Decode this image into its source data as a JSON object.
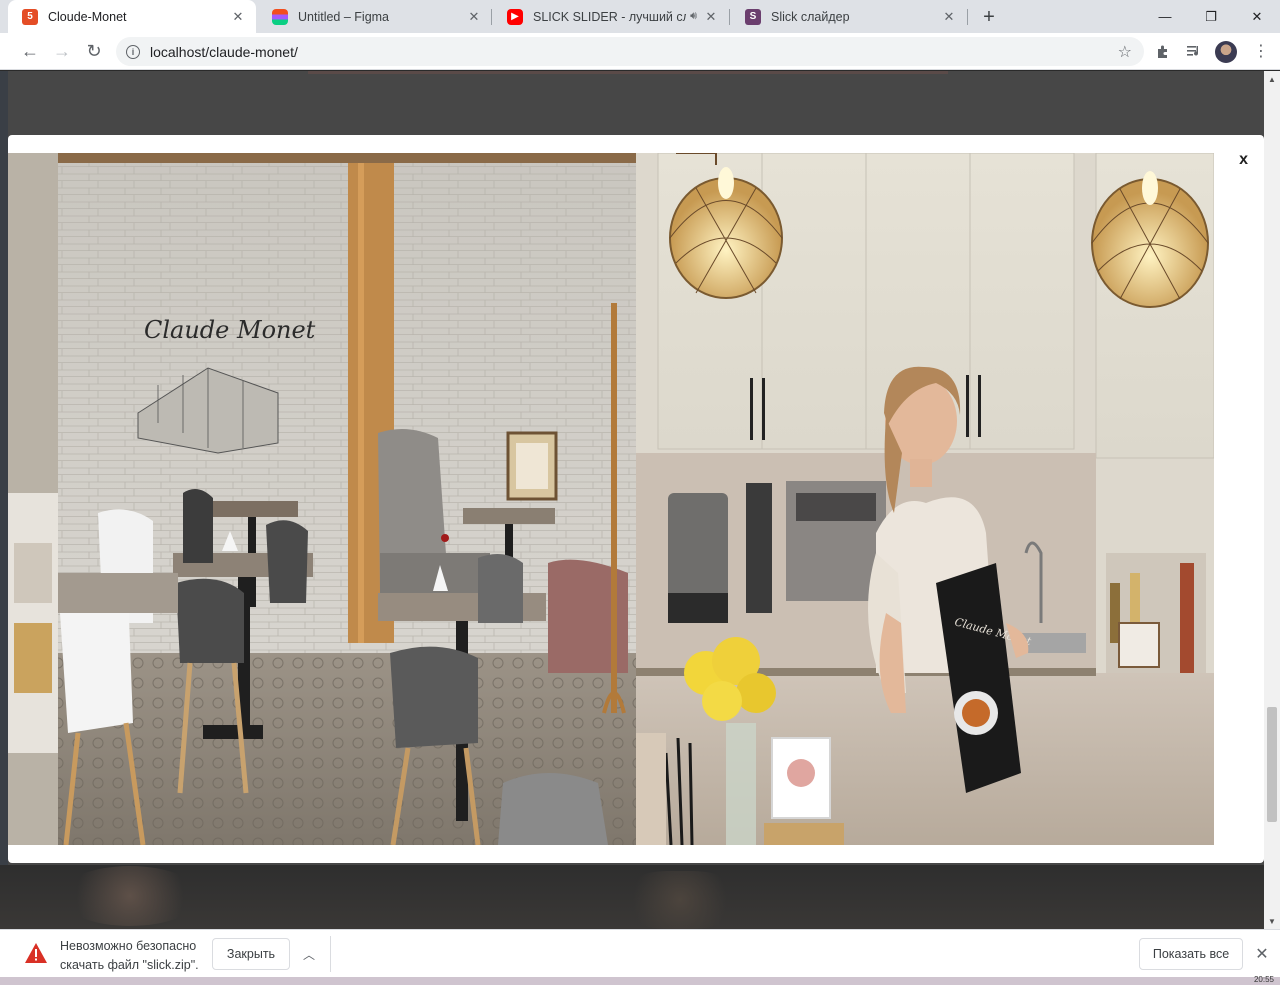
{
  "tabs": [
    {
      "title": "Cloude-Monet",
      "active": true,
      "favicon": "html-icon",
      "color": "#e44d26"
    },
    {
      "title": "Untitled – Figma",
      "active": false,
      "favicon": "figma-icon",
      "color": "#a259ff"
    },
    {
      "title": "SLICK SLIDER - лучший слай",
      "active": false,
      "favicon": "youtube-icon",
      "color": "#ff0000"
    },
    {
      "title": "Slick слайдер",
      "active": false,
      "favicon": "slick-icon",
      "color": "#6b3e6e"
    }
  ],
  "window_controls": {
    "minimize": "—",
    "restore": "❐",
    "close": "✕"
  },
  "toolbar": {
    "url": "localhost/claude-monet/",
    "back": "←",
    "forward": "→",
    "reload": "↻",
    "star": "☆"
  },
  "modal": {
    "close_label": "x",
    "slides": [
      {
        "name": "cafe-interior-photo",
        "sign_text": "Claude Monet"
      },
      {
        "name": "barista-with-menu-photo",
        "menu_text": "Claude Monet"
      }
    ]
  },
  "download_bar": {
    "message_line1": "Невозможно безопасно",
    "message_line2": "скачать файл \"slick.zip\".",
    "close_label": "Закрыть",
    "show_all_label": "Показать все",
    "caret": "︿",
    "dismiss": "✕"
  },
  "taskbar": {
    "clock": "20:55"
  }
}
